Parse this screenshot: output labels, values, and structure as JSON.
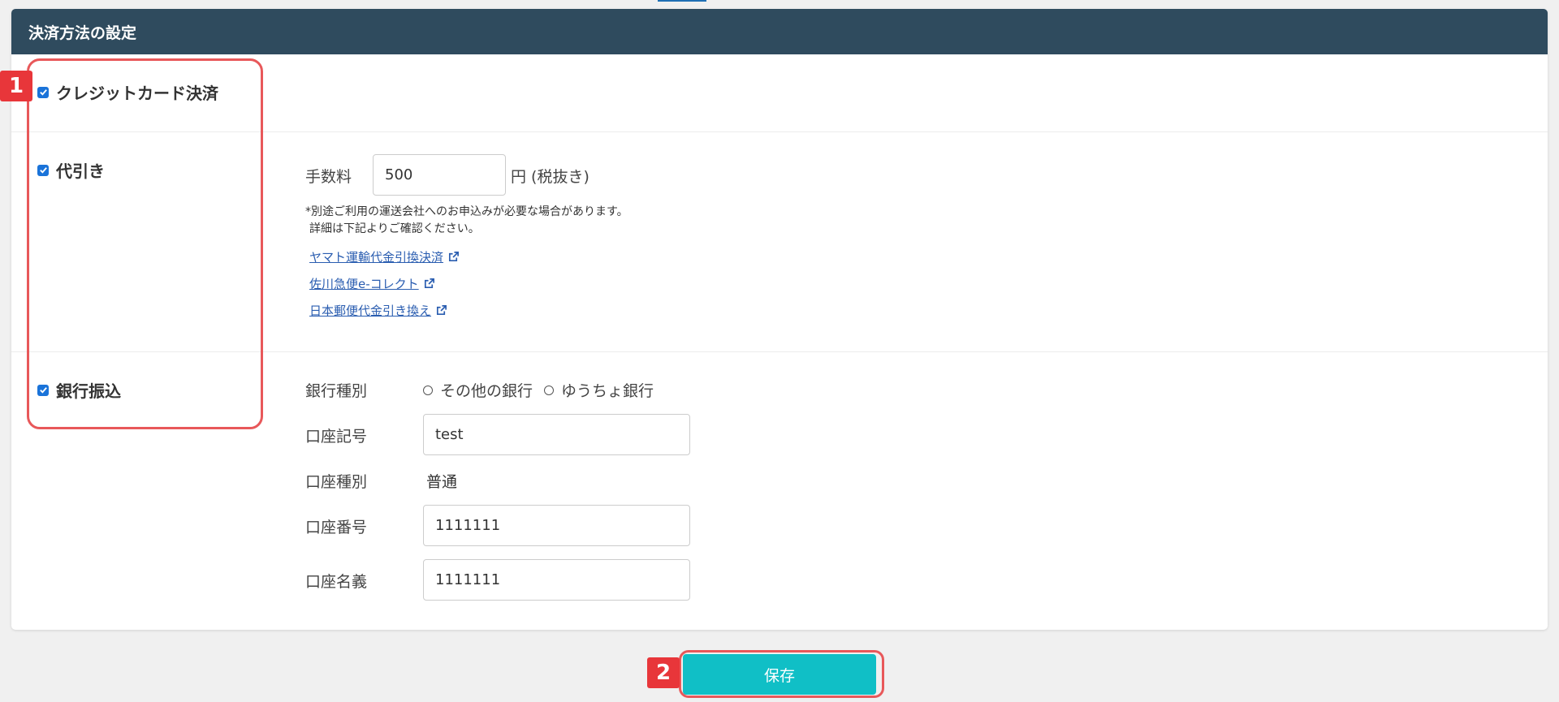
{
  "panel": {
    "title": "決済方法の設定"
  },
  "credit": {
    "label": "クレジットカード決済",
    "checked": true
  },
  "cod": {
    "label": "代引き",
    "checked": true,
    "fee_label": "手数料",
    "fee_value": "500",
    "fee_unit": "円 (税抜き)",
    "note_line1": "*別途ご利用の運送会社へのお申込みが必要な場合があります。",
    "note_line2": "詳細は下記よりご確認ください。",
    "links": [
      "ヤマト運輸代金引換決済",
      "佐川急便e-コレクト",
      "日本郵便代金引き換え"
    ]
  },
  "bank": {
    "label": "銀行振込",
    "checked": true,
    "bank_type_label": "銀行種別",
    "bank_type_options": [
      "その他の銀行",
      "ゆうちょ銀行"
    ],
    "account_code_label": "口座記号",
    "account_code_value": "test",
    "account_type_label": "口座種別",
    "account_type_value": "普通",
    "account_number_label": "口座番号",
    "account_number_value": "1111111",
    "account_name_label": "口座名義",
    "account_name_value": "1111111"
  },
  "save_label": "保存",
  "callouts": [
    "1",
    "2"
  ],
  "colors": {
    "header_bg": "#2f4b5e",
    "accent": "#10bfc6",
    "callout": "#e8363a",
    "checkbox": "#1a73d9",
    "link": "#2a5db0"
  }
}
